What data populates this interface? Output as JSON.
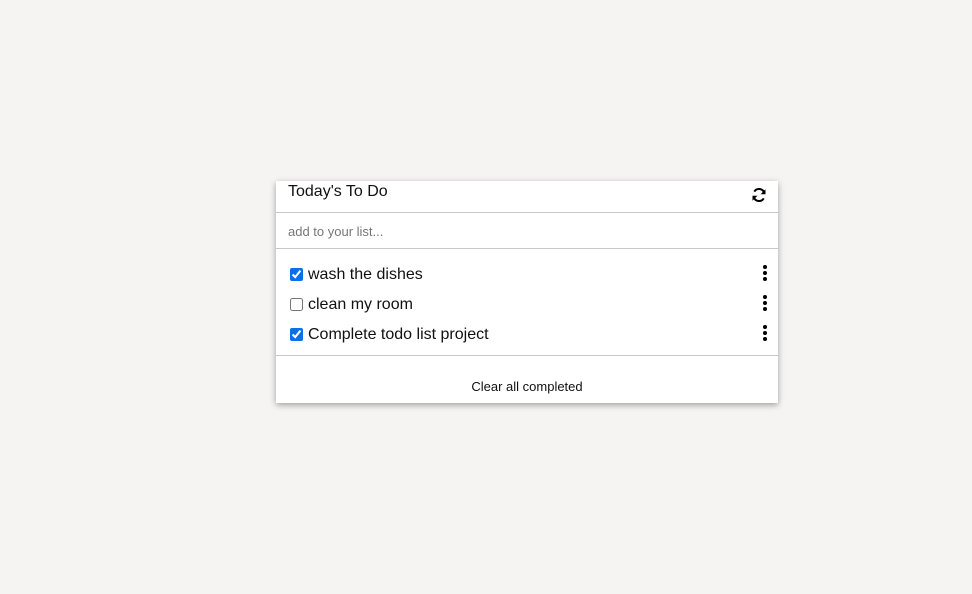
{
  "app": {
    "title": "Today's To Do",
    "refresh_icon": "refresh-icon"
  },
  "add": {
    "placeholder": "add to your list..."
  },
  "todos": [
    {
      "label": "wash the dishes",
      "completed": true
    },
    {
      "label": "clean my room",
      "completed": false
    },
    {
      "label": "Complete todo list project",
      "completed": true
    }
  ],
  "footer": {
    "clear_label": "Clear all completed"
  },
  "colors": {
    "accent": "#0b70e8",
    "background": "#f5f4f2"
  }
}
